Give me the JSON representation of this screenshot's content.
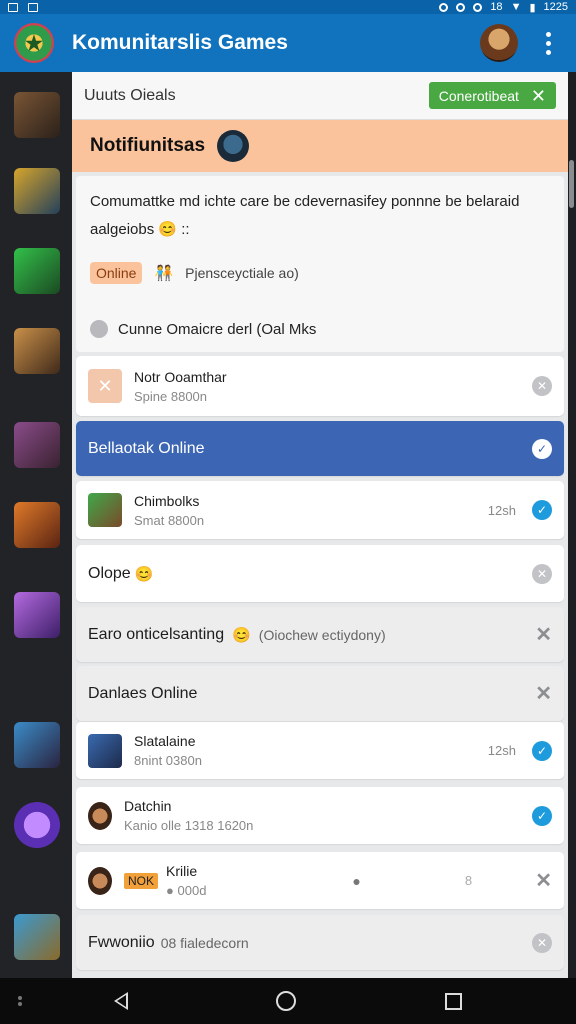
{
  "status_bar": {
    "time": "1225",
    "signal": "18"
  },
  "app_bar": {
    "title": "Komunitarslis Games"
  },
  "rail": {
    "items": [
      "game-1",
      "game-2",
      "game-3",
      "game-4",
      "game-5",
      "game-6",
      "game-7",
      "game-8",
      "game-9",
      "game-10"
    ]
  },
  "filter": {
    "label": "Uuuts Oieals",
    "button_label": "Conerotibeat"
  },
  "notifications": {
    "title": "Notifiunitsas"
  },
  "info_card": {
    "text": "Comumattke md ichte care be cdevernasifey ponnne be belaraid aalgeiobs",
    "text_suffix": "::",
    "online_pill": "Online",
    "pill_sub": "Pjensceyctiale ao)",
    "status_line": "Cunne Omaicre derl (Oal Mks"
  },
  "rows": [
    {
      "name": "Notr Ooamthar",
      "sub": "Spine 8800n"
    },
    {
      "title": "Bellaotak Online"
    },
    {
      "name": "Chimbolks",
      "sub": "Smat 8800n",
      "time": "12sh"
    },
    {
      "title": "Olope"
    },
    {
      "title": "Earo onticelsanting",
      "sub": "(Oiochew ectiydony)"
    },
    {
      "title": "Danlaes Online"
    },
    {
      "name": "Slatalaine",
      "sub": "8nint 0380n",
      "time": "12sh"
    },
    {
      "name": "Datchin",
      "sub": "Kanio olle 1318 1620n"
    },
    {
      "name": "Krilie",
      "sub": "000d",
      "badge": "NOK",
      "mid": "8"
    },
    {
      "title": "Fwwoniio",
      "sub": "08 fialedecorn"
    }
  ],
  "colors": {
    "appbar": "#1173bd",
    "accent_green": "#4aa843",
    "peach": "#fbc39c",
    "active_blue": "#3c66b3",
    "check_blue": "#1e9bdc"
  }
}
